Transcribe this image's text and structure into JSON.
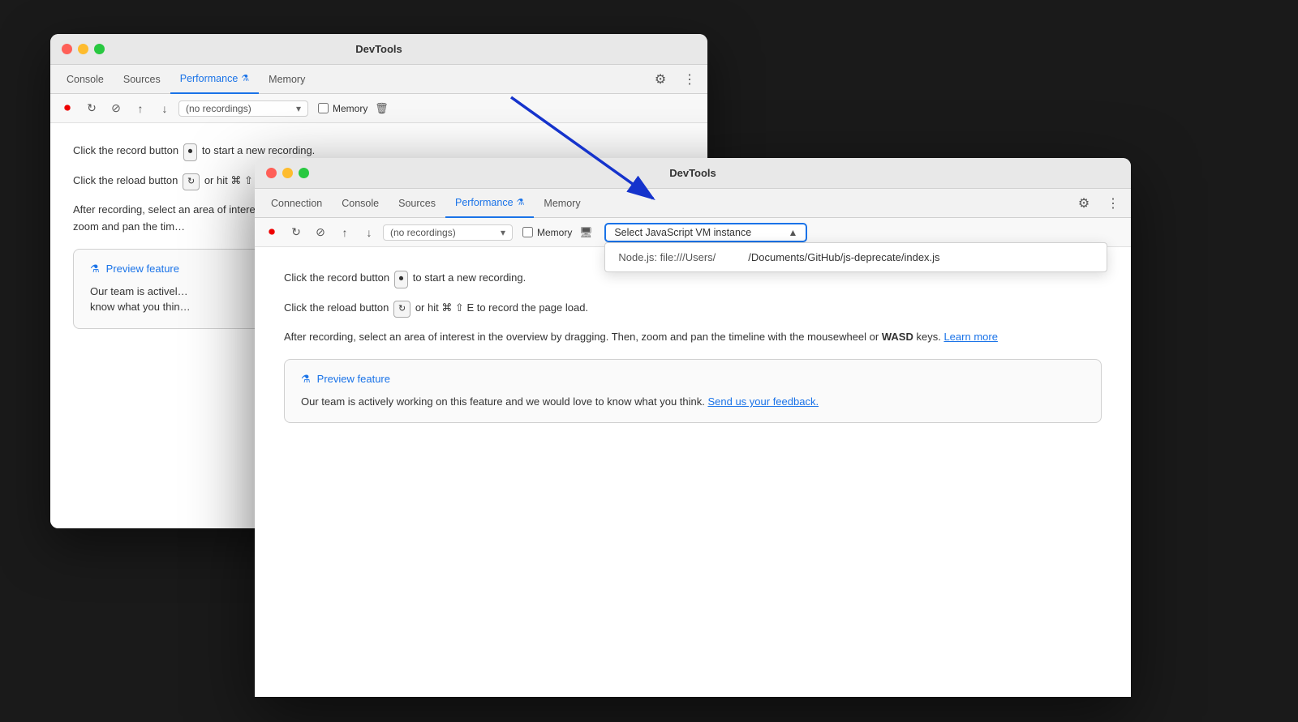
{
  "back_window": {
    "title": "DevTools",
    "tabs": [
      {
        "label": "Console",
        "active": false
      },
      {
        "label": "Sources",
        "active": false
      },
      {
        "label": "Performance",
        "active": true,
        "flask": true
      },
      {
        "label": "Memory",
        "active": false
      }
    ],
    "toolbar": {
      "recordings_placeholder": "(no recordings)",
      "memory_label": "Memory"
    },
    "content": {
      "para1": "Click the record button",
      "para2": "Click the reload button",
      "para3_prefix": "After recording, select an area of interest in the overview by dragging. Then,\nzoom and pan the tim",
      "preview_title": "Preview feature",
      "preview_text_truncated": "Our team is activel\nknow what you thin"
    }
  },
  "front_window": {
    "title": "DevTools",
    "tabs": [
      {
        "label": "Connection",
        "active": false
      },
      {
        "label": "Console",
        "active": false
      },
      {
        "label": "Sources",
        "active": false
      },
      {
        "label": "Performance",
        "active": true,
        "flask": true
      },
      {
        "label": "Memory",
        "active": false
      }
    ],
    "toolbar": {
      "recordings_placeholder": "(no recordings)",
      "memory_label": "Memory"
    },
    "vm_selector": {
      "label": "Select JavaScript VM instance",
      "options": [
        {
          "left": "Node.js: file:///Users/",
          "right": "/Documents/GitHub/js-deprecate/index.js"
        }
      ]
    },
    "content": {
      "para1_prefix": "Click the re",
      "reload_hint": "or hit ⌘ ⇧ E to record the page load.",
      "para2_full": "After recording, select an area of interest in the overview by dragging. Then,\nzoom and pan the timeline with the mousewheel or",
      "para2_bold": "WASD",
      "para2_suffix": "keys.",
      "para2_link": "Learn more",
      "preview_title": "Preview feature",
      "preview_text": "Our team is actively working on this feature and we would love to\nknow what you think.",
      "preview_link": "Send us your feedback."
    }
  }
}
